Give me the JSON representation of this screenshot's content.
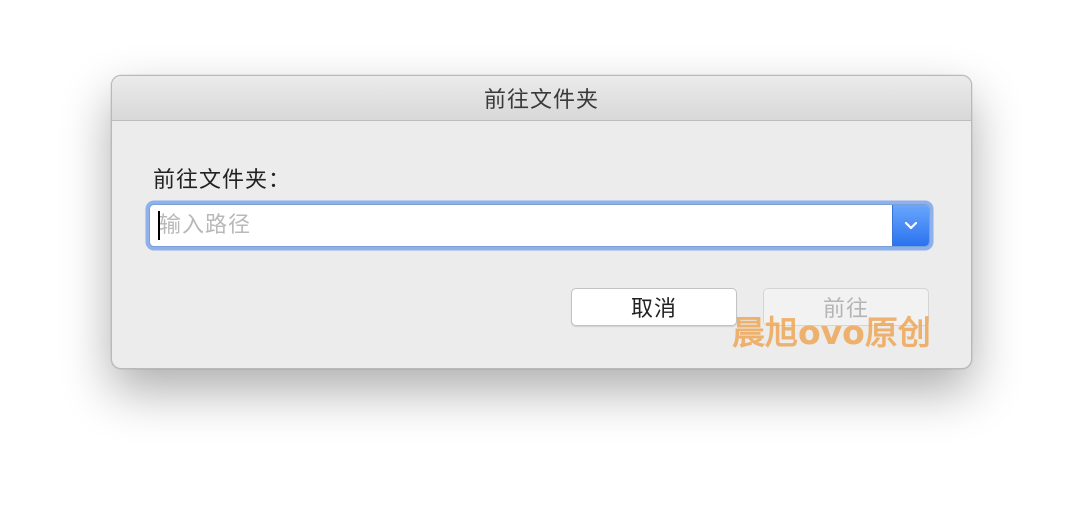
{
  "dialog": {
    "title": "前往文件夹",
    "prompt_label": "前往文件夹：",
    "path_input": {
      "value": "",
      "placeholder": "输入路径"
    },
    "dropdown_icon": "chevron-down-icon",
    "buttons": {
      "cancel_label": "取消",
      "go_label": "前往"
    }
  },
  "watermark": {
    "text": "晨旭ovo原创"
  },
  "colors": {
    "focus_ring": "#8eb1ec",
    "accent": "#2a73f0",
    "watermark": "#eea450"
  }
}
